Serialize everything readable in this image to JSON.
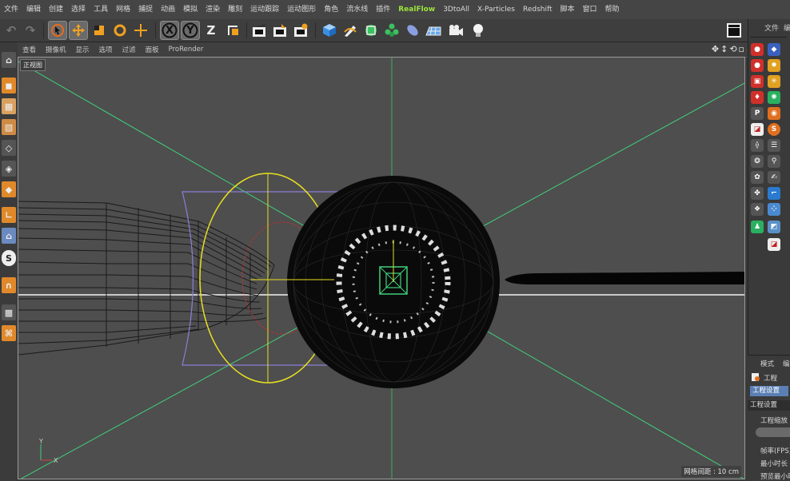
{
  "menu": [
    "文件",
    "编辑",
    "创建",
    "选择",
    "工具",
    "网格",
    "捕捉",
    "动画",
    "模拟",
    "渲染",
    "雕刻",
    "运动跟踪",
    "运动图形",
    "角色",
    "流水线",
    "插件",
    "RealFlow",
    "3DtoAll",
    "X-Particles",
    "Redshift",
    "脚本",
    "窗口",
    "帮助"
  ],
  "menu_highlight": "RealFlow",
  "toolbar": {
    "axis_x": "X",
    "axis_y": "Y",
    "axis_z": "Z"
  },
  "viewport": {
    "menu": [
      "查看",
      "摄像机",
      "显示",
      "选项",
      "过滤",
      "面板",
      "ProRender"
    ],
    "name": "正视图",
    "grid_spacing": "网格间距 : 10 cm",
    "axis_y": "Y",
    "axis_x": "X"
  },
  "right_panel": {
    "tab_top": "文件",
    "tab_top2": "编",
    "tab_bottom": "模式",
    "tab_bottom2": "编"
  },
  "attributes": {
    "project": "工程",
    "tab": "工程设置",
    "section": "工程设置",
    "scale": "工程缩放",
    "fps": "帧率(FPS)",
    "min_time": "最小时长",
    "preview_min": "预览最小时"
  },
  "colors": {
    "accent_green": "#9be33c",
    "guide_green": "#3fd07a",
    "selection_yellow": "#e8e020",
    "deformer_purple": "#8a7fd8"
  }
}
